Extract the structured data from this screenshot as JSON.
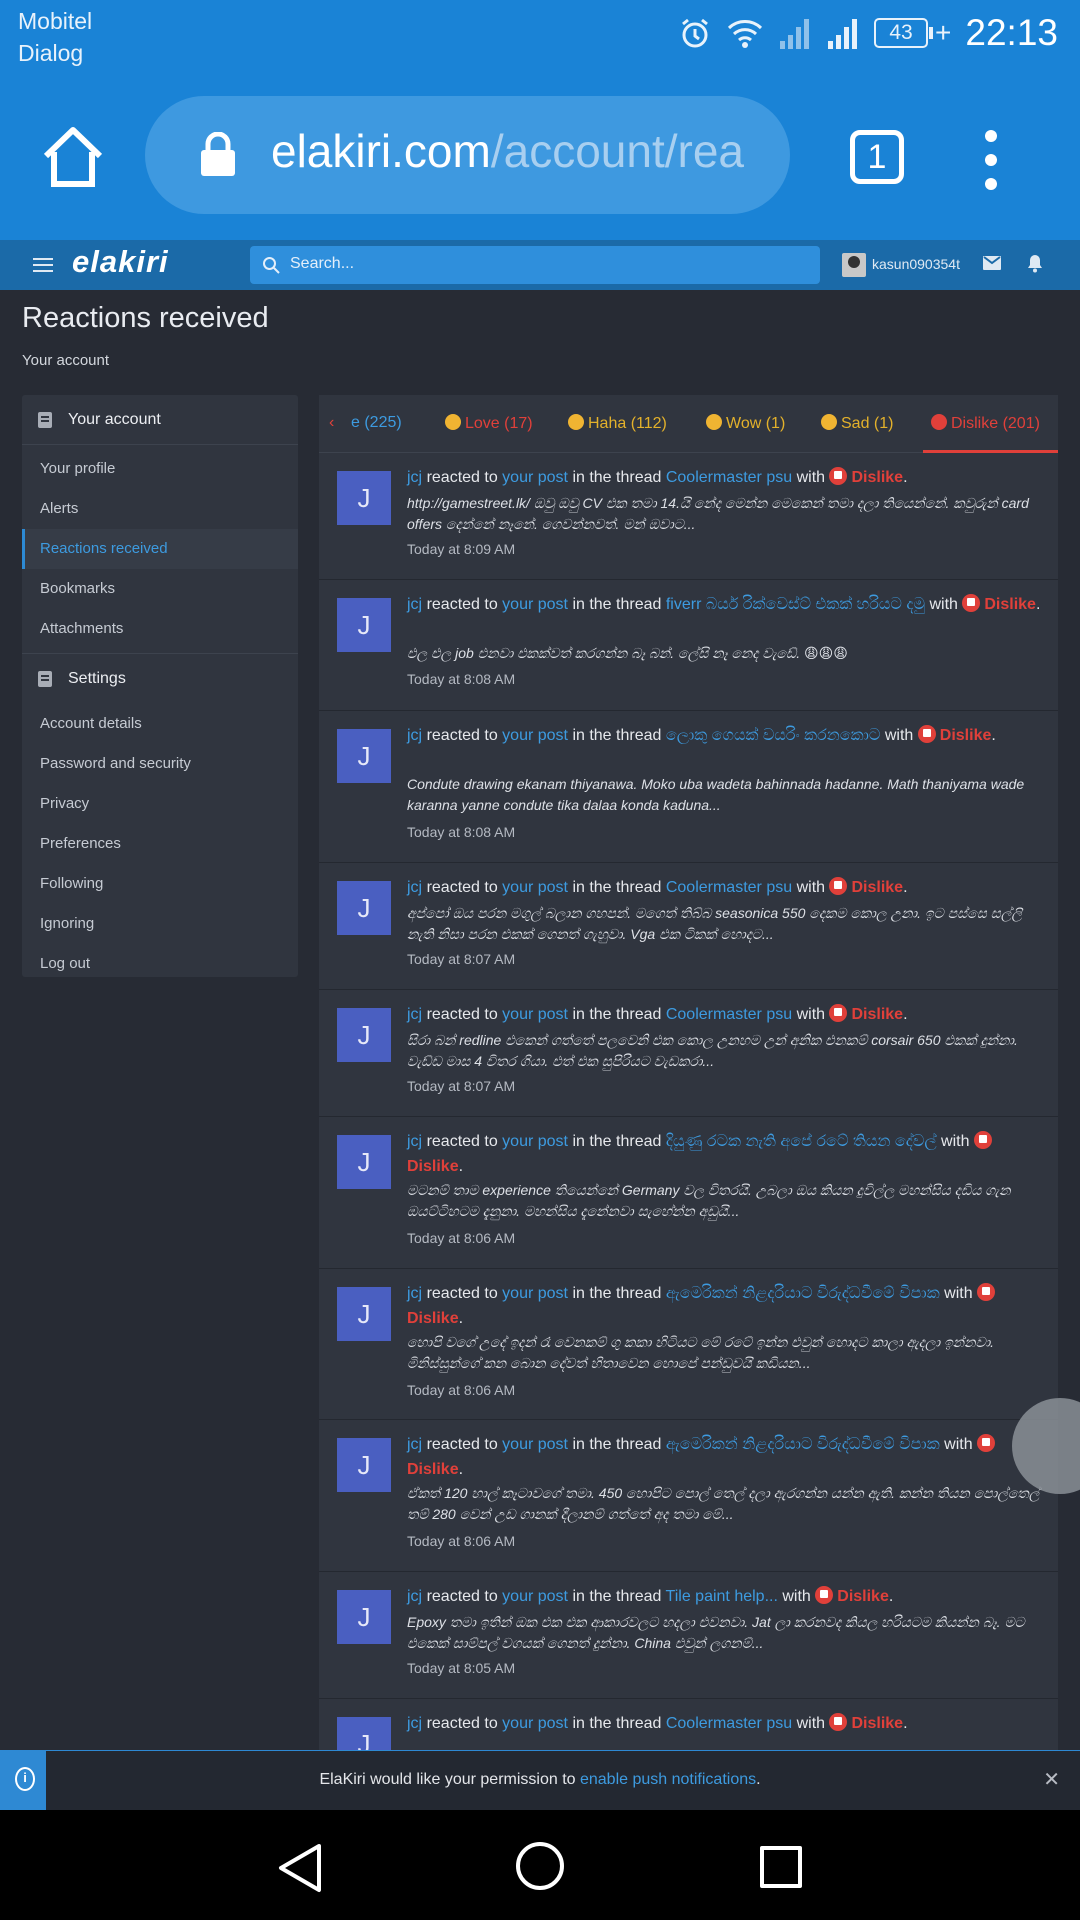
{
  "status_bar": {
    "carrier_1": "Mobitel",
    "carrier_2": "Dialog",
    "battery": "43",
    "time": "22:13"
  },
  "browser": {
    "url_domain": "elakiri.com",
    "url_path": "/account/rea",
    "tab_count": "1"
  },
  "site": {
    "logo": "elakiri",
    "search_placeholder": "Search...",
    "username": "kasun090354t"
  },
  "page": {
    "title": "Reactions received",
    "breadcrumb": "Your account"
  },
  "sidebar": {
    "account_header": "Your account",
    "account_items": [
      "Your profile",
      "Alerts",
      "Reactions received",
      "Bookmarks",
      "Attachments"
    ],
    "settings_header": "Settings",
    "settings_items": [
      "Account details",
      "Password and security",
      "Privacy",
      "Preferences",
      "Following",
      "Ignoring",
      "Log out"
    ]
  },
  "tabs": [
    {
      "label": "e (225)",
      "color": "#3d9be0",
      "emoji": ""
    },
    {
      "label": "Love (17)",
      "color": "#e0403a",
      "emoji": "love"
    },
    {
      "label": "Haha (112)",
      "color": "#e3b12b",
      "emoji": "haha"
    },
    {
      "label": "Wow (1)",
      "color": "#e3b12b",
      "emoji": "wow"
    },
    {
      "label": "Sad (1)",
      "color": "#e3b12b",
      "emoji": "sad"
    },
    {
      "label": "Dislike (201)",
      "color": "#e0403a",
      "emoji": "dislike"
    }
  ],
  "reaction_common": {
    "reacted_to": "reacted to",
    "your_post": "your post",
    "in_the_thread": "in the thread",
    "with": "with",
    "reaction": "Dislike",
    "avatar_letter": "J",
    "user": "jcj"
  },
  "feed": [
    {
      "thread": "Coolermaster psu",
      "snippet": "http://gamestreet.lk/ ඔවු ඔවු CV එක තමා 14.යි නේද මෙන්න මෙකෙන් තමා දලා තියෙන්නේ. කවුරුන් card offers දෙන්නේ නෑනේ. ගෙවන්නවත්. මන් ඔවාට...",
      "time": "Today at 8:09 AM"
    },
    {
      "thread": "fiverr බයර් රික්වෙස්ට් එකක් හරියට දමු",
      "snippet": "එල එල job එනවා එකක්වත් කරගන්න බෑ බන්. ලේසි නෑ නෙද වැඩේ. 😩😩😩",
      "time": "Today at 8:08 AM"
    },
    {
      "thread": "ලොකු ගෙයක් වයරිං කරනකොට",
      "snippet": "Condute drawing ekanam thiyanawa. Moko uba wadeta bahinnada hadanne. Math thaniyama wade karanna yanne condute tika dalaa konda kaduna...",
      "time": "Today at 8:08 AM"
    },
    {
      "thread": "Coolermaster psu",
      "snippet": "අප්පෝ ඔය පරන මගුල් බලාන ගහපන්. මගෙත් තිබ්බ seasonica 550 දෙකම කොල උනා. ඉට පස්සෙ සල්ලි නැති නිසා පරන එකක් ගෙනත් ගැහුවා. Vga එක ටිකක් හොදට...",
      "time": "Today at 8:07 AM"
    },
    {
      "thread": "Coolermaster psu",
      "snippet": "සිරා බන් redline එකෙන් ගත්තේ පලවෙනි එක කොල උනහම උන් අනික එනකම් corsair 650 එකක් දුන්නා. වැඩ්ඩ මාස 4 විතර ගියා. එත් එක සුපිරියට වැඩකරා...",
      "time": "Today at 8:07 AM"
    },
    {
      "thread": "දියුණු රටක නැති අපේ රටේ තියන දේවල්",
      "snippet": "මටනම් තාම experience තියෙන්නේ Germany වල විතරයි. උබලා ඔය කියන දුවිල්ල මහන්සිය දඩිය ගැන ඔයට්ටිහටම දැනුනා. මහන්සිය දැනේනවා සැහේන්න අඩුයි...",
      "time": "Today at 8:06 AM"
    },
    {
      "thread": "ඇමෙරිකන් නිළදරියාට විරුද්ධවීමේ විපාක",
      "snippet": "හොපි වගේ උදේ ඉදන් රෑ වෙනකම් ගු කකා හිටියට මේ රටේ ඉන්න එවුන් හොදට කාලා ඇදලා ඉන්නවා. මිනිස්සුන්ගේ කන බොන දේවත් හිතාවෙන හොපේ පන්ඩුවයි කඩියන...",
      "time": "Today at 8:06 AM"
    },
    {
      "thread": "ඇමෙරිකන් නිළදරියාට විරුද්ධවීමේ විපාක",
      "snippet": "ඒකත් 120 හාල් කෑටාවගේ තමා. 450 හොපිට පොල් තෙල් දලා ඇරගන්න යන්න ඇති. කන්න තියන පොල්තෙල් තම් 280 වෙන් උඩ ගානක් දීලානම් ගත්තේ අද තමා මේ...",
      "time": "Today at 8:06 AM"
    },
    {
      "thread": "Tile paint help...",
      "snippet": "Epoxy තමා ඉතින් ඔක එක එක ආකාරවලට හදලා එවනවා. Jat ලා කරනවද කියල හරියටම කියන්න බෑ. මට එකෙක් සාම්පල් වගයක් ගෙනත් දුන්නා. China එවුන් ලගනම්...",
      "time": "Today at 8:05 AM"
    },
    {
      "thread": "Coolermaster psu",
      "snippet": "",
      "time": ""
    }
  ],
  "notice": {
    "text": "ElaKiri would like your permission to ",
    "link": "enable push notifications",
    "suffix": "."
  },
  "colors": {
    "brand_blue": "#1a83d6",
    "link_blue": "#3d9be0",
    "dislike_red": "#e0403a",
    "avatar_bg": "#4a5fc1"
  }
}
